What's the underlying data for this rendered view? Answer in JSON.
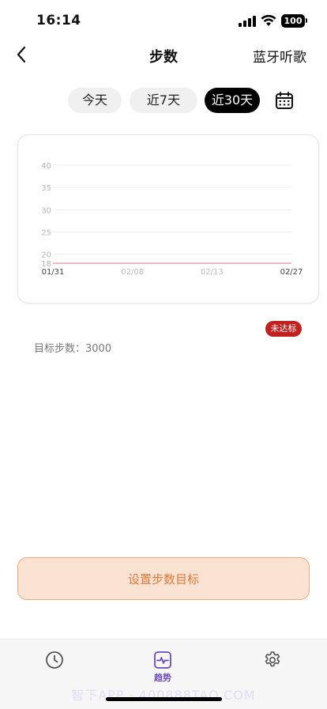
{
  "status": {
    "time": "16:14",
    "battery": "100"
  },
  "nav": {
    "title": "步数",
    "right_label": "蓝牙听歌"
  },
  "tabs": [
    {
      "label": "今天"
    },
    {
      "label": "近7天"
    },
    {
      "label": "近30天",
      "selected": true
    }
  ],
  "chart_data": {
    "type": "line",
    "x": [
      "01/31",
      "02/08",
      "02/13",
      "02/27"
    ],
    "y_ticks": [
      18,
      20,
      25,
      30,
      35,
      40
    ],
    "ylim": [
      18,
      40
    ],
    "grid": true,
    "series": [
      {
        "values": [
          18,
          18,
          18,
          18
        ],
        "color": "#e5a9a9"
      }
    ]
  },
  "goal": {
    "badge": "未达标",
    "text": "目标步数：3000"
  },
  "action": {
    "label": "设置步数目标"
  },
  "tabbar": {
    "trend_label": "趋势"
  },
  "watermark": "智下APP · 400888TAO.COM",
  "colors": {
    "accent": "#6a4bb8",
    "primary_button_bg": "#fbe3d4",
    "primary_button_text": "#e07b3a",
    "badge_red": "#c0201e"
  }
}
